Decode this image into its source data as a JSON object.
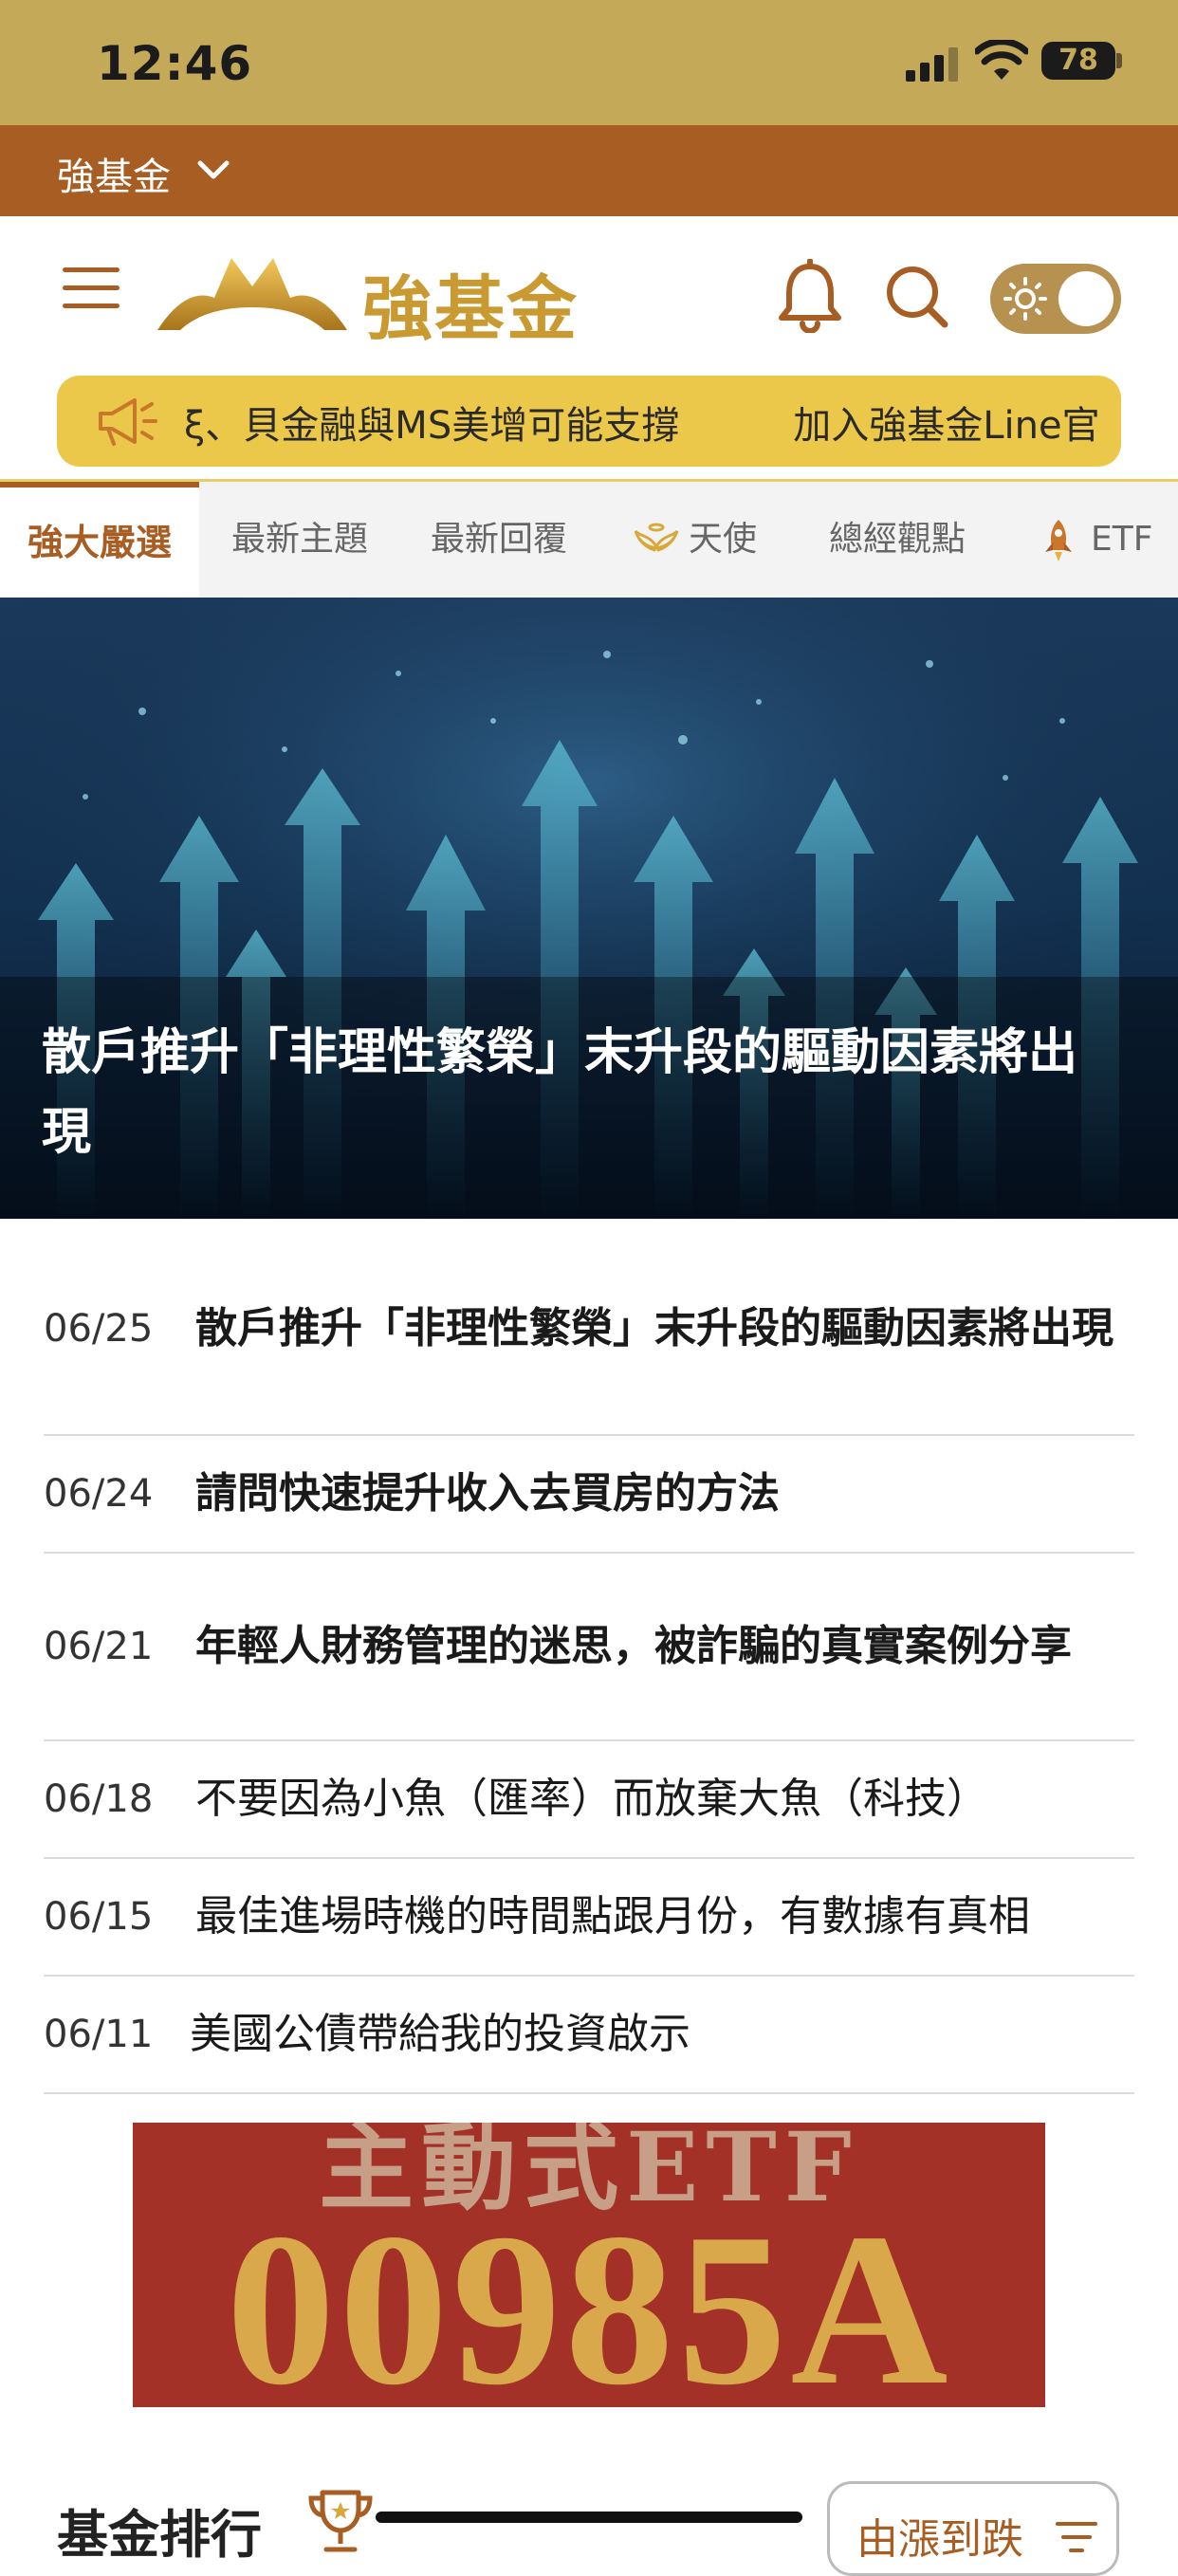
{
  "status": {
    "time": "12:46",
    "battery": "78"
  },
  "site_bar": {
    "label": "強基金"
  },
  "header": {
    "logo_text": "強基金"
  },
  "ticker": {
    "items": [
      "ξ、貝金融與MS美增可能支撐",
      "加入強基金Line官"
    ]
  },
  "tabs": [
    {
      "label": "強大嚴選",
      "active": true
    },
    {
      "label": "最新主題"
    },
    {
      "label": "最新回覆"
    },
    {
      "label": "天使",
      "icon": "angel-wings-icon"
    },
    {
      "label": "總經觀點"
    },
    {
      "label": "ETF",
      "icon": "rocket-icon"
    }
  ],
  "hero": {
    "title": "散戶推升「非理性繁榮」末升段的驅動因素將出現"
  },
  "articles": [
    {
      "date": "06/25",
      "title": "散戶推升「非理性繁榮」末升段的驅動因素將出現",
      "bold": true
    },
    {
      "date": "06/24",
      "title": "請問快速提升收入去買房的方法",
      "bold": true
    },
    {
      "date": "06/21",
      "title": "年輕人財務管理的迷思，被詐騙的真實案例分享",
      "bold": true
    },
    {
      "date": "06/18",
      "title": "不要因為小魚（匯率）而放棄大魚（科技）",
      "bold": false
    },
    {
      "date": "06/15",
      "title": "最佳進場時機的時間點跟月份，有數據有真相",
      "bold": false
    },
    {
      "date": "06/11",
      "title": "美國公債帶給我的投資啟示",
      "bold": false
    }
  ],
  "ad": {
    "top_text": "主動式ETF",
    "code": "00985A"
  },
  "ranking": {
    "title": "基金排行",
    "sort_label": "由漲到跌"
  },
  "colors": {
    "gold": "#c4a958",
    "brown": "#a85d23",
    "ticker_yellow": "#ecc84a"
  }
}
